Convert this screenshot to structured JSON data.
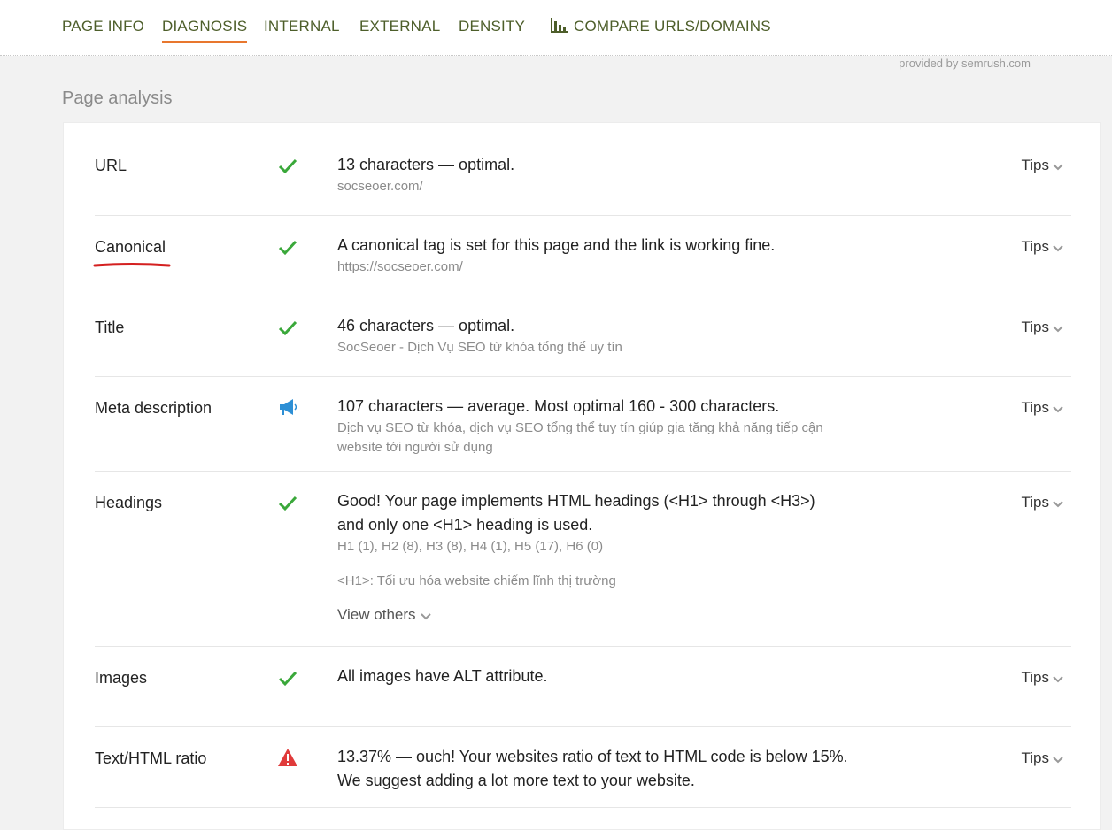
{
  "tabs": [
    {
      "label": "PAGE INFO",
      "active": false
    },
    {
      "label": "DIAGNOSIS",
      "active": true
    },
    {
      "label": "INTERNAL",
      "active": false
    },
    {
      "label": "EXTERNAL",
      "active": false
    },
    {
      "label": "DENSITY",
      "active": false
    },
    {
      "label": "COMPARE URLS/DOMAINS",
      "active": false,
      "icon": "bar-chart-icon"
    }
  ],
  "provided_by": "provided by  semrush.com",
  "section_title": "Page analysis",
  "tips_label": "Tips",
  "colors": {
    "tab_text": "#4d5e2a",
    "tab_active_underline": "#e8772e",
    "ok_check": "#3aa83a",
    "info_blue": "#2d8fd5",
    "warning_red": "#e03a3a",
    "annotation_red": "#d42020"
  },
  "rows": [
    {
      "label": "URL",
      "status_icon": "check-icon",
      "main": "13 characters — optimal.",
      "sub": "socseoer.com/"
    },
    {
      "label": "Canonical",
      "status_icon": "check-icon",
      "main": "A canonical tag is set for this page and the link is working fine.",
      "sub": "https://socseoer.com/"
    },
    {
      "label": "Title",
      "status_icon": "check-icon",
      "main": "46 characters — optimal.",
      "sub": "SocSeoer - Dịch Vụ SEO từ khóa tổng thể uy tín"
    },
    {
      "label": "Meta description",
      "status_icon": "megaphone-icon",
      "main": "107 characters — average. Most optimal 160 - 300 characters.",
      "sub": "Dịch vụ SEO từ khóa, dịch vụ SEO tổng thể tuy tín giúp gia tăng khả năng tiếp cận website tới người sử dụng"
    },
    {
      "label": "Headings",
      "status_icon": "check-icon",
      "main": "Good! Your page implements HTML headings (<H1> through <H3>) and only one <H1> heading is used.",
      "sub": "H1 (1), H2 (8), H3 (8), H4 (1), H5 (17), H6 (0)",
      "sub2": "<H1>: Tối ưu hóa website chiếm lĩnh thị trường",
      "view_others": "View others"
    },
    {
      "label": "Images",
      "status_icon": "check-icon",
      "main": "All images have ALT attribute."
    },
    {
      "label": "Text/HTML ratio",
      "status_icon": "warning-icon",
      "main": "13.37% — ouch! Your websites ratio of text to HTML code is below 15%. We suggest adding a lot more text to your website."
    }
  ]
}
